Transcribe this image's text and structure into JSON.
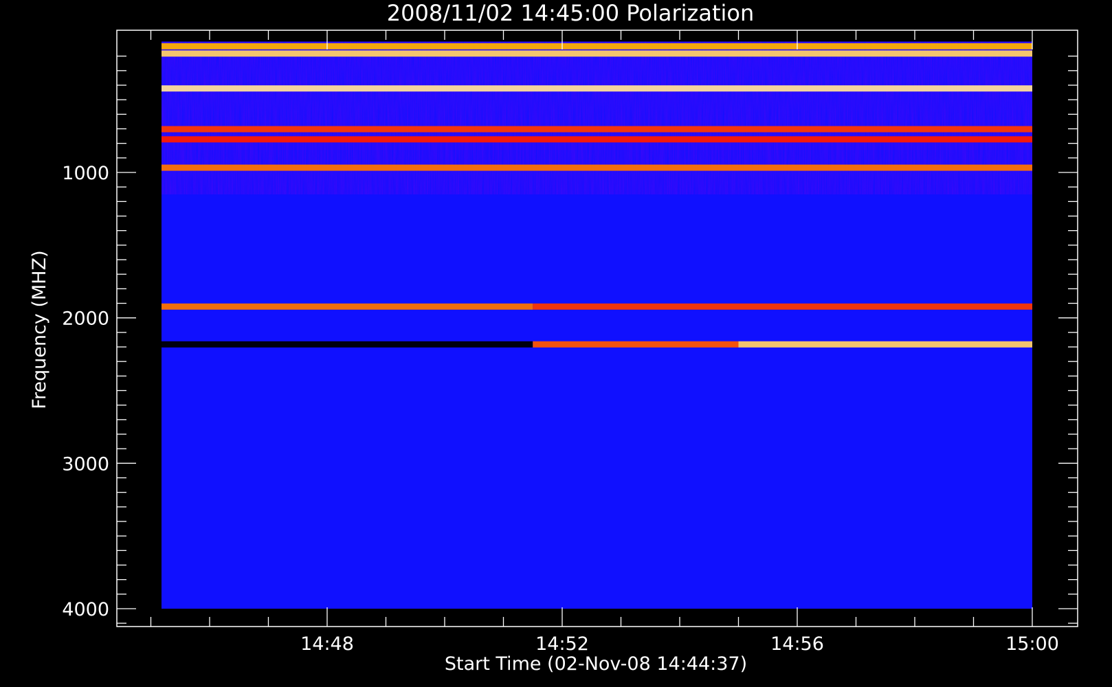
{
  "chart_data": {
    "type": "heatmap",
    "title": "2008/11/02 14:45:00 Polarization",
    "xlabel": "Start Time (02-Nov-08 14:44:37)",
    "ylabel": "Frequency (MHZ)",
    "x_start_time": "14:44:37",
    "x_end_time": "15:00",
    "x_ticks": [
      "14:48",
      "14:52",
      "14:56",
      "15:00"
    ],
    "y_ticks": [
      1000,
      2000,
      3000,
      4000
    ],
    "ylim": [
      100,
      4120
    ],
    "y_reversed": true,
    "data_extent_mhz": [
      100,
      4000
    ],
    "colormap": [
      "#000000",
      "#1010ff",
      "#ff1a00",
      "#ffb000",
      "#ffffff"
    ],
    "background_color": "#1010ff",
    "features": [
      {
        "freq_mhz": 130,
        "start": "14:45:00",
        "end": "15:00",
        "intensity": 0.75
      },
      {
        "freq_mhz": 180,
        "start": "14:45:00",
        "end": "15:00",
        "intensity": 0.85
      },
      {
        "freq_mhz": 420,
        "start": "14:45:00",
        "end": "15:00",
        "intensity": 0.9
      },
      {
        "freq_mhz": 700,
        "start": "14:45:00",
        "end": "15:00",
        "intensity": 0.55
      },
      {
        "freq_mhz": 770,
        "start": "14:45:00",
        "end": "15:00",
        "intensity": 0.5
      },
      {
        "freq_mhz": 965,
        "start": "14:45:00",
        "end": "15:00",
        "intensity": 0.65
      },
      {
        "freq_mhz": 1920,
        "start": "14:45:00",
        "end": "14:51:30",
        "intensity": 0.65
      },
      {
        "freq_mhz": 1920,
        "start": "14:51:30",
        "end": "15:00",
        "intensity": 0.55
      },
      {
        "freq_mhz": 2180,
        "start": "14:45:00",
        "end": "14:51:30",
        "intensity": 0.0
      },
      {
        "freq_mhz": 2180,
        "start": "14:51:30",
        "end": "14:55:00",
        "intensity": 0.6
      },
      {
        "freq_mhz": 2180,
        "start": "14:55:00",
        "end": "15:00",
        "intensity": 0.85
      }
    ]
  }
}
